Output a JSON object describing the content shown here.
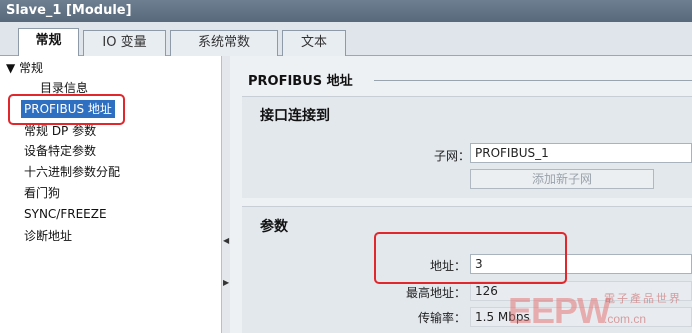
{
  "window": {
    "title": "Slave_1 [Module]"
  },
  "tabs": [
    {
      "label": "常规"
    },
    {
      "label": "IO 变量"
    },
    {
      "label": "系统常数"
    },
    {
      "label": "文本"
    }
  ],
  "sidebar": {
    "items": [
      {
        "label": "▼ 常规"
      },
      {
        "label": "目录信息"
      },
      {
        "label": "PROFIBUS 地址"
      },
      {
        "label": "常规 DP 参数"
      },
      {
        "label": "设备特定参数"
      },
      {
        "label": "十六进制参数分配"
      },
      {
        "label": "看门狗"
      },
      {
        "label": "SYNC/FREEZE"
      },
      {
        "label": "诊断地址"
      }
    ]
  },
  "main": {
    "section_title": "PROFIBUS 地址",
    "interface_group": {
      "title": "接口连接到",
      "subnet_label": "子网：",
      "subnet_value": "PROFIBUS_1",
      "add_subnet_button": "添加新子网"
    },
    "params_group": {
      "title": "参数",
      "address_label": "地址：",
      "address_value": "3",
      "max_address_label": "最高地址：",
      "max_address_value": "126",
      "baud_label": "传输率：",
      "baud_value": "1.5 Mbps"
    }
  },
  "watermark": {
    "logo": "EEPW",
    "cn": "電子產品世界",
    "url": ".com.cn"
  },
  "colors": {
    "selection": "#2f6fc2",
    "highlight_box": "#e2272c",
    "titlebar": "#5f7185"
  }
}
